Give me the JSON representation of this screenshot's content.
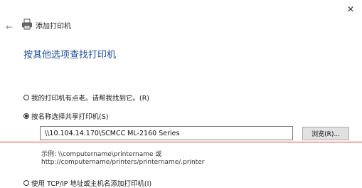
{
  "window": {
    "title": "添加打印机",
    "close_glyph": "✕",
    "back_glyph": "←"
  },
  "heading": "按其他选项查找打印机",
  "options": [
    {
      "label": "我的打印机有点老。请帮我找到它。(R)",
      "checked": false
    },
    {
      "label": "按名称选择共享打印机(S)",
      "checked": true
    },
    {
      "label": "使用 TCP/IP 地址或主机名添加打印机(I)",
      "checked": false
    }
  ],
  "shared_printer": {
    "value": "\\\\10.104.14.170\\SCMCC ML-2160 Series",
    "browse_label": "浏览(R)...",
    "example_line1": "示例: \\\\computername\\printername 或",
    "example_line2": "http://computername/printers/printername/.printer"
  },
  "colors": {
    "heading": "#1f4e99",
    "annotation_line": "#e2453a"
  },
  "icons": {
    "close": "close-icon",
    "back": "back-arrow-icon",
    "printer": "printer-icon"
  }
}
